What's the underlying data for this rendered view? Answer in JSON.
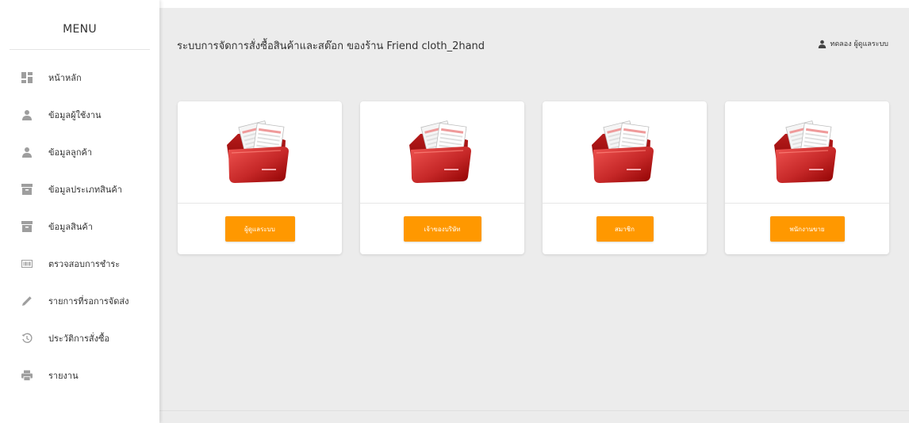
{
  "sidebar": {
    "title": "MENU",
    "items": [
      {
        "label": "หน้าหลัก",
        "icon": "dashboard-icon"
      },
      {
        "label": "ข้อมูลผู้ใช้งาน",
        "icon": "person-icon"
      },
      {
        "label": "ข้อมูลลูกค้า",
        "icon": "person-icon"
      },
      {
        "label": "ข้อมูลประเภทสินค้า",
        "icon": "archive-icon"
      },
      {
        "label": "ข้อมูลสินค้า",
        "icon": "archive-icon"
      },
      {
        "label": "ตรวจสอบการชำระ",
        "icon": "barcode-icon"
      },
      {
        "label": "รายการที่รอการจัดส่ง",
        "icon": "pencil-icon"
      },
      {
        "label": "ประวัติการสั่งซื้อ",
        "icon": "history-icon"
      },
      {
        "label": "รายงาน",
        "icon": "print-icon"
      }
    ]
  },
  "header": {
    "title": "ระบบการจัดการสั่งซื้อสินค้าและสต๊อก ของร้าน Friend cloth_2hand",
    "user": "ทดลอง ผู้ดูแลระบบ",
    "user_icon": "person-icon"
  },
  "cards": [
    {
      "button": "ผู้ดูแลระบบ",
      "icon": "red-folder-icon"
    },
    {
      "button": "เจ้าของบริษัท",
      "icon": "red-folder-icon"
    },
    {
      "button": "สมาชิก",
      "icon": "red-folder-icon"
    },
    {
      "button": "พนักงานขาย",
      "icon": "red-folder-icon"
    }
  ],
  "colors": {
    "accent": "#ff9800",
    "background": "#ececec",
    "sidebar": "#ffffff",
    "folder": "#c62828"
  }
}
